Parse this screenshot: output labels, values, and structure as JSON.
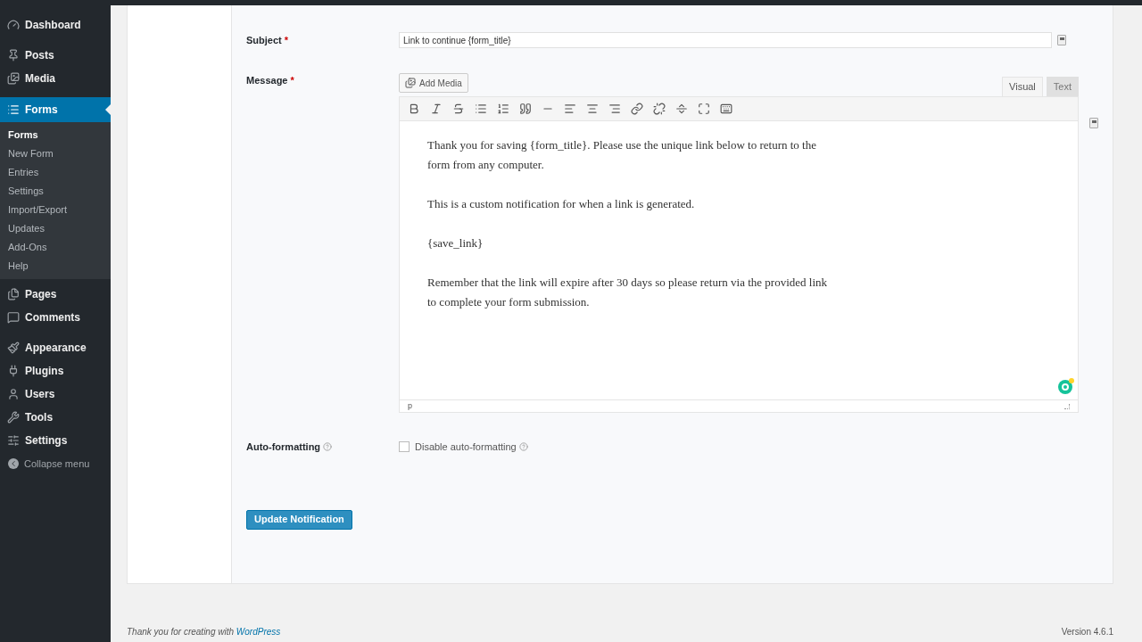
{
  "sidebar": {
    "items": [
      {
        "label": "Dashboard",
        "selected": false
      },
      {
        "label": "Posts",
        "selected": false
      },
      {
        "label": "Media",
        "selected": false
      },
      {
        "label": "Forms",
        "selected": true,
        "children": [
          {
            "label": "Forms",
            "selected": true
          },
          {
            "label": "New Form",
            "selected": false
          },
          {
            "label": "Entries",
            "selected": false
          },
          {
            "label": "Settings",
            "selected": false
          },
          {
            "label": "Import/Export",
            "selected": false
          },
          {
            "label": "Updates",
            "selected": false
          },
          {
            "label": "Add-Ons",
            "selected": false
          },
          {
            "label": "Help",
            "selected": false
          }
        ]
      },
      {
        "label": "Pages",
        "selected": false
      },
      {
        "label": "Comments",
        "selected": false
      },
      {
        "label": "Appearance",
        "selected": false
      },
      {
        "label": "Plugins",
        "selected": false
      },
      {
        "label": "Users",
        "selected": false
      },
      {
        "label": "Tools",
        "selected": false
      },
      {
        "label": "Settings",
        "selected": false
      }
    ],
    "collapse": "Collapse menu"
  },
  "subject": {
    "label": "Subject",
    "required": "*",
    "value": "Link to continue {form_title}"
  },
  "message": {
    "label": "Message",
    "required": "*",
    "add_media": "Add Media",
    "tabs": [
      {
        "label": "Visual",
        "selected": true
      },
      {
        "label": "Text",
        "selected": false
      }
    ],
    "paragraphs": [
      "Thank you for saving {form_title}. Please use the unique link below to return to the form from any computer.",
      "This is a custom notification for when a link is generated.",
      "{save_link}",
      "Remember that the link will expire after 30 days so please return via the provided link to complete your form submission."
    ],
    "path": "p"
  },
  "autoformat": {
    "label": "Auto-formatting",
    "checkbox_label": "Disable auto-formatting",
    "checked": false
  },
  "submit": "Update Notification",
  "footer": {
    "text": "Thank you for creating with",
    "link": "WordPress",
    "version": "Version 4.6.1"
  }
}
